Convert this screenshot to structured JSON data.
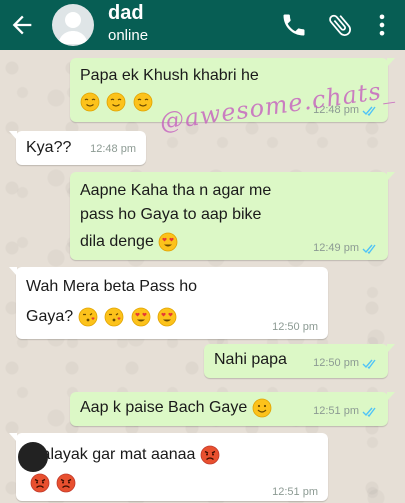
{
  "header": {
    "contact_name": "dad",
    "status": "online",
    "color": "#075e54"
  },
  "icons": {
    "back": "arrow-left",
    "call": "phone",
    "attach": "paperclip",
    "menu": "more-vertical"
  },
  "watermark": "@awesome.chats_",
  "messages": [
    {
      "direction": "out",
      "lines": [
        "Papa ek Khush khabri he"
      ],
      "emojis": [
        "relieved",
        "relieved",
        "relieved"
      ],
      "time": "12:48 pm",
      "ticks": "read"
    },
    {
      "direction": "in",
      "lines": [
        "Kya??"
      ],
      "time": "12:48 pm"
    },
    {
      "direction": "out",
      "lines": [
        "Aapne Kaha tha n agar me",
        "pass ho Gaya to aap bike",
        "dila denge"
      ],
      "emojis": [
        "heart-eyes"
      ],
      "time": "12:49 pm",
      "ticks": "read"
    },
    {
      "direction": "in",
      "lines": [
        "Wah Mera beta Pass ho",
        "Gaya?"
      ],
      "emojis": [
        "kiss",
        "kiss",
        "heart-eyes",
        "heart-eyes"
      ],
      "time": "12:50 pm"
    },
    {
      "direction": "out",
      "lines": [
        "Nahi papa"
      ],
      "time": "12:50 pm",
      "ticks": "read"
    },
    {
      "direction": "out",
      "lines": [
        "Aap k paise Bach Gaye"
      ],
      "emojis": [
        "smile"
      ],
      "time": "12:51 pm",
      "ticks": "read"
    },
    {
      "direction": "in",
      "lines": [
        "Nalayak gar mat aanaa"
      ],
      "emojis": [
        "angry",
        "angry",
        "angry"
      ],
      "time": "12:51 pm"
    }
  ],
  "colors": {
    "outgoing_bubble": "#dcf8c6",
    "incoming_bubble": "#ffffff",
    "read_ticks": "#4fc3f7",
    "watermark": "#c768c0"
  }
}
